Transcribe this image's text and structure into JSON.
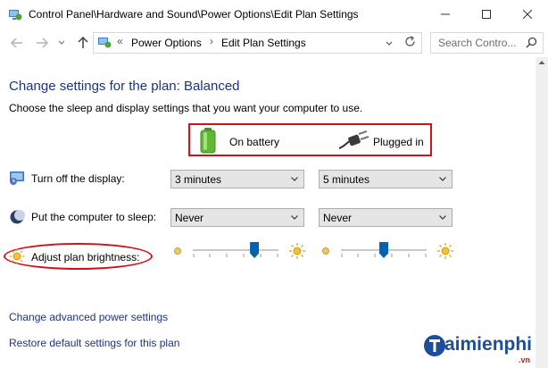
{
  "window": {
    "title": "Control Panel\\Hardware and Sound\\Power Options\\Edit Plan Settings"
  },
  "address": {
    "overflow": "«",
    "crumbs": [
      "Power Options",
      "Edit Plan Settings"
    ]
  },
  "search": {
    "placeholder": "Search Contro..."
  },
  "main": {
    "heading": "Change settings for the plan: Balanced",
    "subtext": "Choose the sleep and display settings that you want your computer to use.",
    "columns": {
      "battery": "On battery",
      "plugged": "Plugged in"
    },
    "rows": [
      {
        "label": "Turn off the display:",
        "battery": "3 minutes",
        "plugged": "5 minutes"
      },
      {
        "label": "Put the computer to sleep:",
        "battery": "Never",
        "plugged": "Never"
      },
      {
        "label": "Adjust plan brightness:",
        "battery_level": 0.72,
        "plugged_level": 0.5
      }
    ],
    "links": {
      "advanced": "Change advanced power settings",
      "restore": "Restore default settings for this plan"
    }
  },
  "watermark": {
    "text": "aimienphi",
    "sub": ".vn"
  },
  "colors": {
    "highlight_red": "#d0121b",
    "link_blue": "#1e3287",
    "slider_blue": "#0063b1"
  },
  "icons": [
    "control-panel-icon",
    "minimize-icon",
    "maximize-icon",
    "close-icon",
    "back-arrow-icon",
    "forward-arrow-icon",
    "up-arrow-icon",
    "refresh-icon",
    "search-icon",
    "battery-icon",
    "plug-icon",
    "monitor-icon",
    "moon-icon",
    "sun-icon"
  ]
}
